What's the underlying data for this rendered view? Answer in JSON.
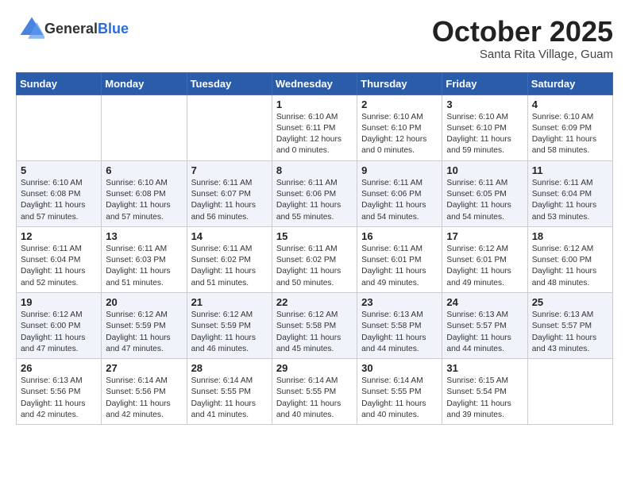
{
  "header": {
    "logo_general": "General",
    "logo_blue": "Blue",
    "month": "October 2025",
    "location": "Santa Rita Village, Guam"
  },
  "days_of_week": [
    "Sunday",
    "Monday",
    "Tuesday",
    "Wednesday",
    "Thursday",
    "Friday",
    "Saturday"
  ],
  "weeks": [
    [
      {
        "day": "",
        "info": ""
      },
      {
        "day": "",
        "info": ""
      },
      {
        "day": "",
        "info": ""
      },
      {
        "day": "1",
        "info": "Sunrise: 6:10 AM\nSunset: 6:11 PM\nDaylight: 12 hours\nand 0 minutes."
      },
      {
        "day": "2",
        "info": "Sunrise: 6:10 AM\nSunset: 6:10 PM\nDaylight: 12 hours\nand 0 minutes."
      },
      {
        "day": "3",
        "info": "Sunrise: 6:10 AM\nSunset: 6:10 PM\nDaylight: 11 hours\nand 59 minutes."
      },
      {
        "day": "4",
        "info": "Sunrise: 6:10 AM\nSunset: 6:09 PM\nDaylight: 11 hours\nand 58 minutes."
      }
    ],
    [
      {
        "day": "5",
        "info": "Sunrise: 6:10 AM\nSunset: 6:08 PM\nDaylight: 11 hours\nand 57 minutes."
      },
      {
        "day": "6",
        "info": "Sunrise: 6:10 AM\nSunset: 6:08 PM\nDaylight: 11 hours\nand 57 minutes."
      },
      {
        "day": "7",
        "info": "Sunrise: 6:11 AM\nSunset: 6:07 PM\nDaylight: 11 hours\nand 56 minutes."
      },
      {
        "day": "8",
        "info": "Sunrise: 6:11 AM\nSunset: 6:06 PM\nDaylight: 11 hours\nand 55 minutes."
      },
      {
        "day": "9",
        "info": "Sunrise: 6:11 AM\nSunset: 6:06 PM\nDaylight: 11 hours\nand 54 minutes."
      },
      {
        "day": "10",
        "info": "Sunrise: 6:11 AM\nSunset: 6:05 PM\nDaylight: 11 hours\nand 54 minutes."
      },
      {
        "day": "11",
        "info": "Sunrise: 6:11 AM\nSunset: 6:04 PM\nDaylight: 11 hours\nand 53 minutes."
      }
    ],
    [
      {
        "day": "12",
        "info": "Sunrise: 6:11 AM\nSunset: 6:04 PM\nDaylight: 11 hours\nand 52 minutes."
      },
      {
        "day": "13",
        "info": "Sunrise: 6:11 AM\nSunset: 6:03 PM\nDaylight: 11 hours\nand 51 minutes."
      },
      {
        "day": "14",
        "info": "Sunrise: 6:11 AM\nSunset: 6:02 PM\nDaylight: 11 hours\nand 51 minutes."
      },
      {
        "day": "15",
        "info": "Sunrise: 6:11 AM\nSunset: 6:02 PM\nDaylight: 11 hours\nand 50 minutes."
      },
      {
        "day": "16",
        "info": "Sunrise: 6:11 AM\nSunset: 6:01 PM\nDaylight: 11 hours\nand 49 minutes."
      },
      {
        "day": "17",
        "info": "Sunrise: 6:12 AM\nSunset: 6:01 PM\nDaylight: 11 hours\nand 49 minutes."
      },
      {
        "day": "18",
        "info": "Sunrise: 6:12 AM\nSunset: 6:00 PM\nDaylight: 11 hours\nand 48 minutes."
      }
    ],
    [
      {
        "day": "19",
        "info": "Sunrise: 6:12 AM\nSunset: 6:00 PM\nDaylight: 11 hours\nand 47 minutes."
      },
      {
        "day": "20",
        "info": "Sunrise: 6:12 AM\nSunset: 5:59 PM\nDaylight: 11 hours\nand 47 minutes."
      },
      {
        "day": "21",
        "info": "Sunrise: 6:12 AM\nSunset: 5:59 PM\nDaylight: 11 hours\nand 46 minutes."
      },
      {
        "day": "22",
        "info": "Sunrise: 6:12 AM\nSunset: 5:58 PM\nDaylight: 11 hours\nand 45 minutes."
      },
      {
        "day": "23",
        "info": "Sunrise: 6:13 AM\nSunset: 5:58 PM\nDaylight: 11 hours\nand 44 minutes."
      },
      {
        "day": "24",
        "info": "Sunrise: 6:13 AM\nSunset: 5:57 PM\nDaylight: 11 hours\nand 44 minutes."
      },
      {
        "day": "25",
        "info": "Sunrise: 6:13 AM\nSunset: 5:57 PM\nDaylight: 11 hours\nand 43 minutes."
      }
    ],
    [
      {
        "day": "26",
        "info": "Sunrise: 6:13 AM\nSunset: 5:56 PM\nDaylight: 11 hours\nand 42 minutes."
      },
      {
        "day": "27",
        "info": "Sunrise: 6:14 AM\nSunset: 5:56 PM\nDaylight: 11 hours\nand 42 minutes."
      },
      {
        "day": "28",
        "info": "Sunrise: 6:14 AM\nSunset: 5:55 PM\nDaylight: 11 hours\nand 41 minutes."
      },
      {
        "day": "29",
        "info": "Sunrise: 6:14 AM\nSunset: 5:55 PM\nDaylight: 11 hours\nand 40 minutes."
      },
      {
        "day": "30",
        "info": "Sunrise: 6:14 AM\nSunset: 5:55 PM\nDaylight: 11 hours\nand 40 minutes."
      },
      {
        "day": "31",
        "info": "Sunrise: 6:15 AM\nSunset: 5:54 PM\nDaylight: 11 hours\nand 39 minutes."
      },
      {
        "day": "",
        "info": ""
      }
    ]
  ]
}
